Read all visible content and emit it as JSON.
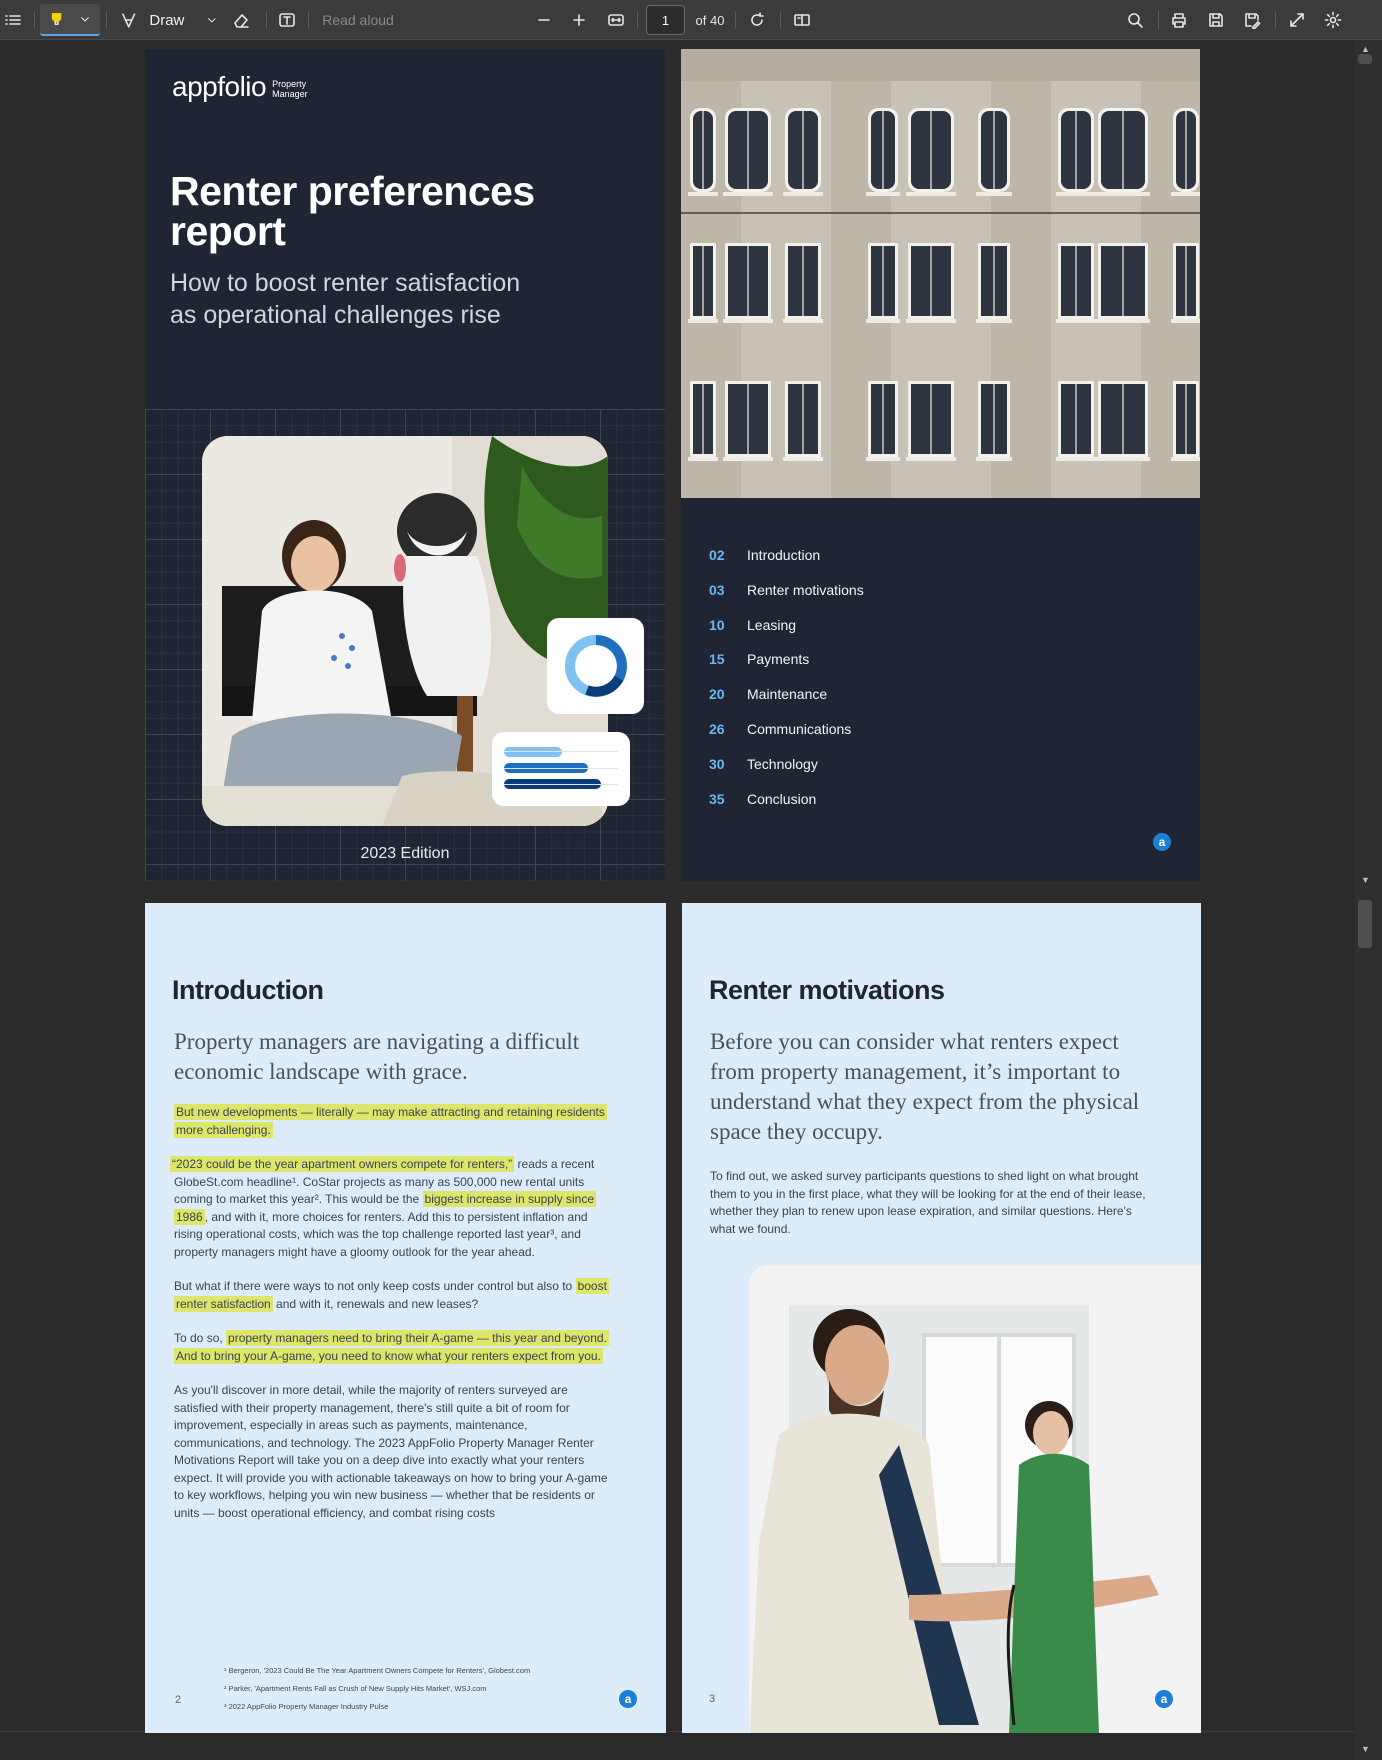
{
  "toolbar": {
    "draw_label": "Draw",
    "read_aloud_label": "Read aloud",
    "page_number": "1",
    "page_total": "of 40"
  },
  "cover": {
    "logo_text": "appfolio",
    "logo_sub_1": "Property",
    "logo_sub_2": "Manager",
    "title_line_1": "Renter preferences",
    "title_line_2": "report",
    "subtitle_line_1": "How to boost renter satisfaction",
    "subtitle_line_2": "as operational challenges rise",
    "edition": "2023 Edition"
  },
  "toc": {
    "items": [
      {
        "num": "02",
        "label": "Introduction"
      },
      {
        "num": "03",
        "label": "Renter motivations"
      },
      {
        "num": "10",
        "label": "Leasing"
      },
      {
        "num": "15",
        "label": "Payments"
      },
      {
        "num": "20",
        "label": "Maintenance"
      },
      {
        "num": "26",
        "label": "Communications"
      },
      {
        "num": "30",
        "label": "Technology"
      },
      {
        "num": "35",
        "label": "Conclusion"
      }
    ]
  },
  "intro": {
    "heading": "Introduction",
    "lead_1": "Property managers are navigating a difficult",
    "lead_2": "economic landscape with grace.",
    "p1_l1": "But new developments — literally — may make attracting and retaining residents",
    "p1_l2": "more challenging.",
    "p2_hl": "“2023 could be the year apartment owners compete for renters,”",
    "p2_a": " reads a recent",
    "p2_l2": "GlobeSt.com headline¹. CoStar projects as many as 500,000 new rental units",
    "p2_l3a": "coming to market this year². This would be the ",
    "p2_l3hl": "biggest increase in supply since",
    "p2_l4hl": "1986",
    "p2_l4": ", and with it, more choices for renters. Add this to persistent inflation and",
    "p2_l5": "rising operational costs, which was the top challenge reported last year³, and",
    "p2_l6": "property managers might have a gloomy outlook for the year ahead.",
    "p3_l1a": "But what if there were ways to not only keep costs under control but also to ",
    "p3_l1hl": "boost",
    "p3_l2hl": "renter satisfaction",
    "p3_l2": " and with it, renewals and new leases?",
    "p4_l1a": "To do so, ",
    "p4_l1hl": "property managers need to bring their A-game — this year and beyond.",
    "p4_l2hl": "And to bring your A-game, you need to know what your renters expect from you.",
    "p5_l1": "As you'll discover in more detail, while the majority of renters surveyed are",
    "p5_l2": "satisfied with their property management, there's still quite a bit of room for",
    "p5_l3": "improvement, especially in areas such as payments, maintenance,",
    "p5_l4": "communications, and technology. The 2023 AppFolio Property Manager Renter",
    "p5_l5": "Motivations Report will take you on a deep dive into exactly what your renters",
    "p5_l6": "expect. It will provide you with actionable takeaways on how to bring your A-game",
    "p5_l7": "to key workflows, helping you win new business — whether that be residents or",
    "p5_l8": "units — boost operational efficiency, and combat rising costs",
    "fn1": "¹  Bergeron, '2023 Could Be The Year Apartment Owners Compete for Renters', Globest.com",
    "fn2": "²  Parker, 'Apartment Rents Fall as Crush of New Supply Hits Market', WSJ.com",
    "fn3": "³  2022 AppFolio Property Manager Industry Pulse",
    "page_num": "2"
  },
  "motivations": {
    "heading": "Renter motivations",
    "lead_1": "Before you can consider what renters expect",
    "lead_2": "from property management, it’s important to",
    "lead_3": "understand what they expect from the physical",
    "lead_4": "space they occupy.",
    "p1_l1": "To find out, we asked survey participants questions to shed light on what brought",
    "p1_l2": "them to you in the first place, what they will be looking for at the end of their lease,",
    "p1_l3": "whether they plan to renew upon lease expiration, and similar questions. Here's",
    "p1_l4": "what we found.",
    "page_num": "3"
  },
  "brand_mark": "a",
  "colors": {
    "navy": "#1f2533",
    "light_blue": "#dcecfb",
    "accent": "#6cb7ef",
    "highlight": "#dde56a"
  }
}
